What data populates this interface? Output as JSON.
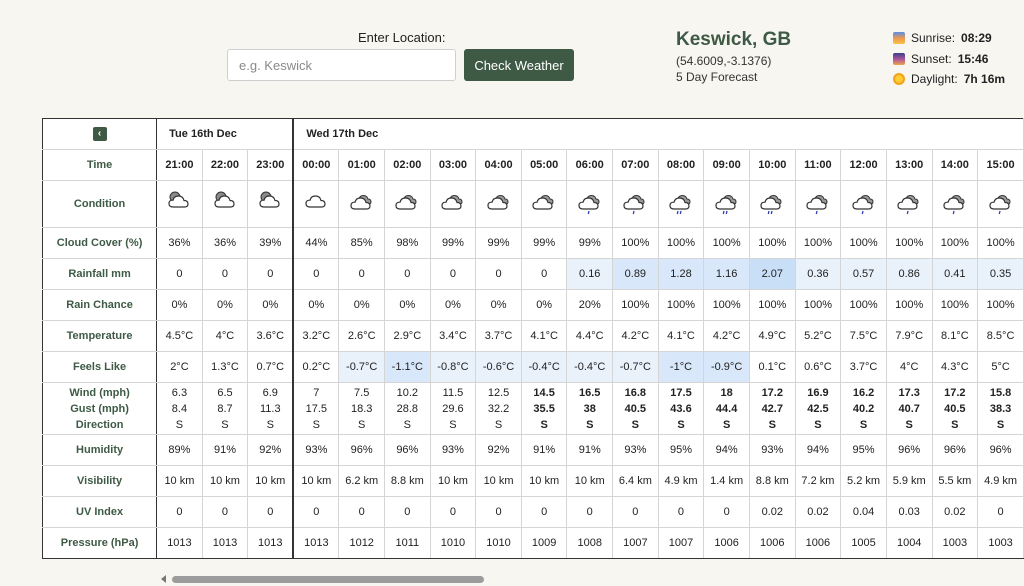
{
  "location": {
    "label": "Enter Location:",
    "placeholder": "e.g. Keswick",
    "value": "",
    "button": "Check Weather"
  },
  "place": {
    "name": "Keswick, GB",
    "coords": "(54.6009,-3.1376)",
    "forecast": "5 Day Forecast"
  },
  "sun": {
    "sunrise_label": "Sunrise:",
    "sunrise": "08:29",
    "sunset_label": "Sunset:",
    "sunset": "15:46",
    "daylight_label": "Daylight:",
    "daylight": "7h 16m"
  },
  "table": {
    "back_icon": "‹",
    "days": [
      {
        "label": "Tue 16th Dec",
        "span": 3
      },
      {
        "label": "Wed 17th Dec",
        "span": 16
      }
    ],
    "row_labels": {
      "time": "Time",
      "condition": "Condition",
      "cloud": "Cloud Cover (%)",
      "rain": "Rainfall mm",
      "chance": "Rain Chance",
      "temp": "Temperature",
      "feels": "Feels Like",
      "wind": "Wind (mph)",
      "gust": "Gust (mph)",
      "direction": "Direction",
      "humidity": "Humidity",
      "visibility": "Visibility",
      "uv": "UV Index",
      "pressure": "Pressure (hPa)"
    },
    "times": [
      "21:00",
      "22:00",
      "23:00",
      "00:00",
      "01:00",
      "02:00",
      "03:00",
      "04:00",
      "05:00",
      "06:00",
      "07:00",
      "08:00",
      "09:00",
      "10:00",
      "11:00",
      "12:00",
      "13:00",
      "14:00",
      "15:00"
    ],
    "conditions": [
      "partly-cloudy-night-icon",
      "partly-cloudy-night-icon",
      "partly-cloudy-night-icon",
      "cloud-icon",
      "overcast-icon",
      "overcast-icon",
      "overcast-icon",
      "overcast-icon",
      "overcast-icon",
      "light-rain-icon",
      "light-rain-icon",
      "rain-icon",
      "rain-icon",
      "rain-icon",
      "light-rain-icon",
      "light-rain-icon",
      "light-rain-icon",
      "light-rain-icon",
      "light-rain-icon"
    ],
    "cloud": [
      "36%",
      "36%",
      "39%",
      "44%",
      "85%",
      "98%",
      "99%",
      "99%",
      "99%",
      "99%",
      "100%",
      "100%",
      "100%",
      "100%",
      "100%",
      "100%",
      "100%",
      "100%",
      "100%"
    ],
    "rain": [
      "0",
      "0",
      "0",
      "0",
      "0",
      "0",
      "0",
      "0",
      "0",
      "0.16",
      "0.89",
      "1.28",
      "1.16",
      "2.07",
      "0.36",
      "0.57",
      "0.86",
      "0.41",
      "0.35"
    ],
    "rain_level": [
      0,
      0,
      0,
      0,
      0,
      0,
      0,
      0,
      0,
      1,
      2,
      2,
      2,
      3,
      1,
      1,
      1,
      1,
      1
    ],
    "chance": [
      "0%",
      "0%",
      "0%",
      "0%",
      "0%",
      "0%",
      "0%",
      "0%",
      "0%",
      "20%",
      "100%",
      "100%",
      "100%",
      "100%",
      "100%",
      "100%",
      "100%",
      "100%",
      "100%"
    ],
    "temp": [
      "4.5°C",
      "4°C",
      "3.6°C",
      "3.2°C",
      "2.6°C",
      "2.9°C",
      "3.4°C",
      "3.7°C",
      "4.1°C",
      "4.4°C",
      "4.2°C",
      "4.1°C",
      "4.2°C",
      "4.9°C",
      "5.2°C",
      "7.5°C",
      "7.9°C",
      "8.1°C",
      "8.5°C"
    ],
    "feels": [
      "2°C",
      "1.3°C",
      "0.7°C",
      "0.2°C",
      "-0.7°C",
      "-1.1°C",
      "-0.8°C",
      "-0.6°C",
      "-0.4°C",
      "-0.4°C",
      "-0.7°C",
      "-1°C",
      "-0.9°C",
      "0.1°C",
      "0.6°C",
      "3.7°C",
      "4°C",
      "4.3°C",
      "5°C"
    ],
    "feels_level": [
      0,
      0,
      0,
      0,
      1,
      2,
      1,
      1,
      1,
      1,
      1,
      2,
      2,
      0,
      0,
      0,
      0,
      0,
      0
    ],
    "wind": [
      "6.3",
      "6.5",
      "6.9",
      "7",
      "7.5",
      "10.2",
      "11.5",
      "12.5",
      "14.5",
      "16.5",
      "16.8",
      "17.5",
      "18",
      "17.2",
      "16.9",
      "16.2",
      "17.3",
      "17.2",
      "15.8"
    ],
    "gust": [
      "8.4",
      "8.7",
      "11.3",
      "17.5",
      "18.3",
      "28.8",
      "29.6",
      "32.2",
      "35.5",
      "38",
      "40.5",
      "43.6",
      "44.4",
      "42.7",
      "42.5",
      "40.2",
      "40.7",
      "40.5",
      "38.3"
    ],
    "direction": [
      "S",
      "S",
      "S",
      "S",
      "S",
      "S",
      "S",
      "S",
      "S",
      "S",
      "S",
      "S",
      "S",
      "S",
      "S",
      "S",
      "S",
      "S",
      "S"
    ],
    "wind_bold": [
      false,
      false,
      false,
      false,
      false,
      false,
      false,
      false,
      true,
      true,
      true,
      true,
      true,
      true,
      true,
      true,
      true,
      true,
      true
    ],
    "humidity": [
      "89%",
      "91%",
      "92%",
      "93%",
      "96%",
      "96%",
      "93%",
      "92%",
      "91%",
      "91%",
      "93%",
      "95%",
      "94%",
      "93%",
      "94%",
      "95%",
      "96%",
      "96%",
      "96%"
    ],
    "visibility": [
      "10 km",
      "10 km",
      "10 km",
      "10 km",
      "6.2 km",
      "8.8 km",
      "10 km",
      "10 km",
      "10 km",
      "10 km",
      "6.4 km",
      "4.9 km",
      "1.4 km",
      "8.8 km",
      "7.2 km",
      "5.2 km",
      "5.9 km",
      "5.5 km",
      "4.9 km"
    ],
    "uv": [
      "0",
      "0",
      "0",
      "0",
      "0",
      "0",
      "0",
      "0",
      "0",
      "0",
      "0",
      "0",
      "0",
      "0.02",
      "0.02",
      "0.04",
      "0.03",
      "0.02",
      "0"
    ],
    "pressure": [
      "1013",
      "1013",
      "1013",
      "1013",
      "1012",
      "1011",
      "1010",
      "1010",
      "1009",
      "1008",
      "1007",
      "1007",
      "1006",
      "1006",
      "1006",
      "1005",
      "1004",
      "1003",
      "1003"
    ]
  },
  "colors": {
    "accent": "#3e5a45",
    "rain_light": "#e9f1fb",
    "rain_mid": "#d8e7f9",
    "rain_strong": "#c9dff7"
  }
}
